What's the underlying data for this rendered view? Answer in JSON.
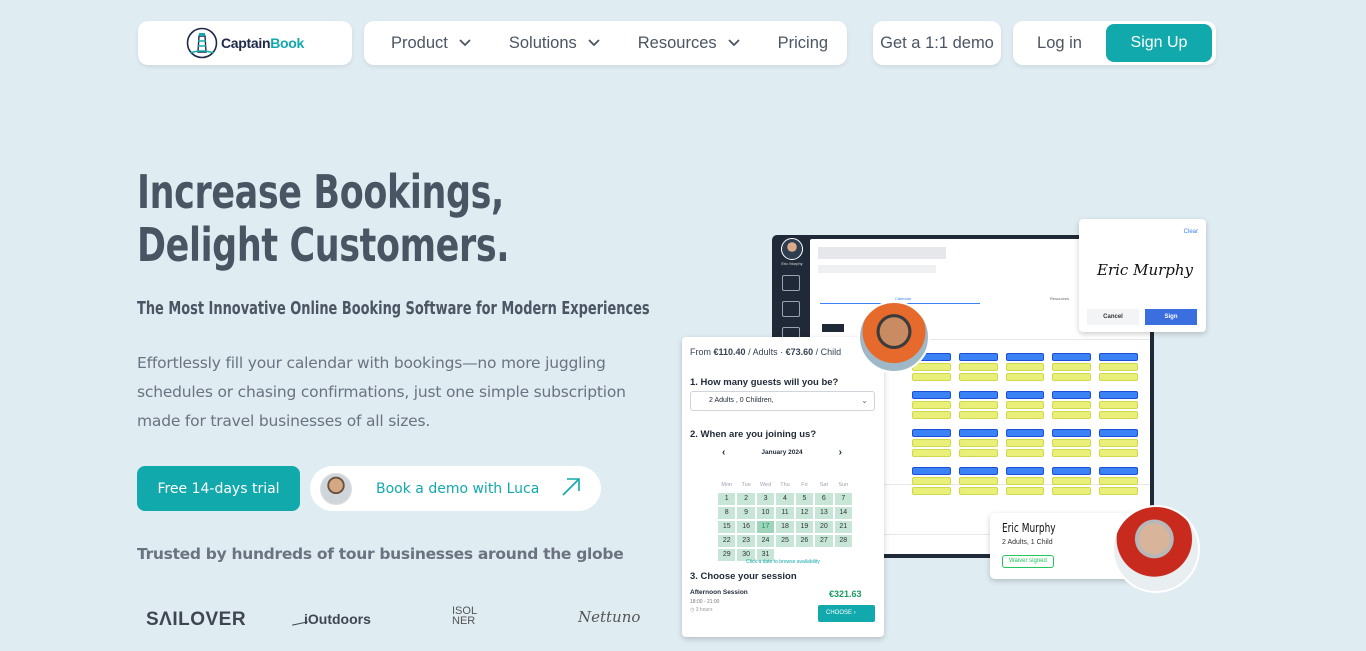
{
  "brand": {
    "logo_prefix": "Captain",
    "logo_suffix": "Book",
    "logo_icon": "lighthouse-icon"
  },
  "nav": {
    "items": [
      {
        "label": "Product",
        "has_dropdown": true
      },
      {
        "label": "Solutions",
        "has_dropdown": true
      },
      {
        "label": "Resources",
        "has_dropdown": true
      },
      {
        "label": "Pricing",
        "has_dropdown": false
      }
    ],
    "demo_label": "Get a 1:1 demo",
    "login_label": "Log in",
    "signup_label": "Sign Up"
  },
  "hero": {
    "title_line1": "Increase Bookings,",
    "title_line2": "Delight Customers.",
    "subtitle": "The Most Innovative Online Booking Software for Modern Experiences",
    "description": "Effortlessly fill your calendar with bookings—no more juggling schedules or chasing confirmations, just one simple subscription made for travel businesses of all sizes.",
    "trial_button": "Free 14-days trial",
    "demo_button": "Book a demo with Luca",
    "trusted_text": "Trusted by hundreds of tour businesses around the globe"
  },
  "logos": [
    "SΛILOVER",
    "iOutdoors",
    "ISOL NER",
    "Nettuno"
  ],
  "illustration": {
    "signature": {
      "clear": "Clear",
      "name": "Eric Murphy",
      "cancel": "Cancel",
      "sign": "Sign"
    },
    "guest_card": {
      "name": "Eric Murphy",
      "party": "2 Adults, 1 Child",
      "badge": "Waiver signed"
    },
    "monitor_user": "Eric Murphy",
    "monitor_tab1": "Calendar",
    "monitor_tab2": "Resources",
    "form": {
      "from_label": "From",
      "adult_price": "€110.40",
      "adult_unit": "/ Adults",
      "child_price": "€73.60",
      "child_unit": "/ Child",
      "q1": "1. How many guests will you be?",
      "guests_value": "2 Adults , 0 Children,",
      "q2": "2. When are you joining us?",
      "month": "January",
      "year": "2024",
      "weekdays": [
        "Mon",
        "Tue",
        "Wed",
        "Thu",
        "Fri",
        "Sat",
        "Sun"
      ],
      "days": [
        1,
        2,
        3,
        4,
        5,
        6,
        7,
        8,
        9,
        10,
        11,
        12,
        13,
        14,
        15,
        16,
        17,
        18,
        19,
        20,
        21,
        22,
        23,
        24,
        25,
        26,
        27,
        28,
        29,
        30,
        31
      ],
      "selected_day": 17,
      "hint": "Click a date to browse availability",
      "q3": "3. Choose your session",
      "session_name": "Afternoon Session",
      "session_time": "18:00 - 21:00",
      "session_duration": "3 hours",
      "session_price": "€321.63",
      "choose": "CHOOSE"
    }
  },
  "colors": {
    "accent": "#12a9ad",
    "background": "#dfecf2",
    "text": "#4a5563"
  }
}
